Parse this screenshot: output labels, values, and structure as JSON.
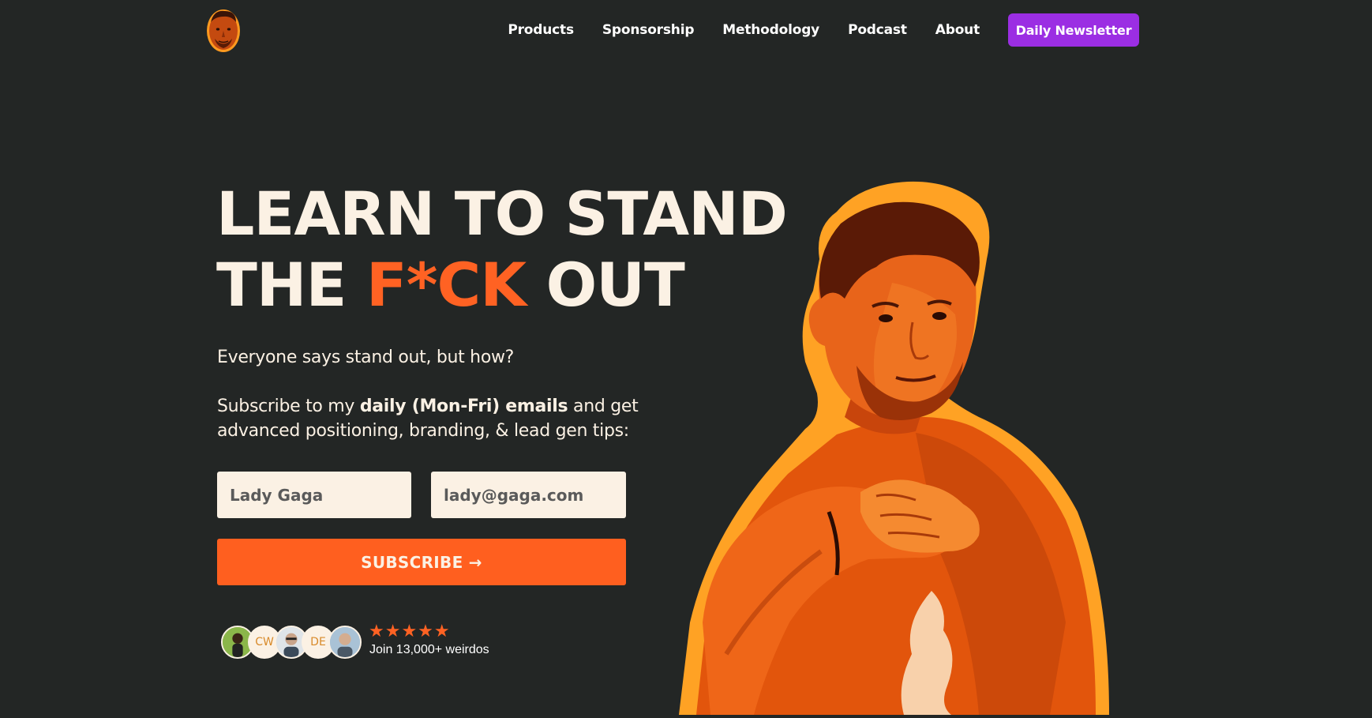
{
  "nav": {
    "items": [
      "Products",
      "Sponsorship",
      "Methodology",
      "Podcast",
      "About"
    ],
    "cta_label": "Daily Newsletter"
  },
  "hero": {
    "headline_line1": "LEARN TO STAND",
    "headline_line2_start": "THE",
    "headline_accent": "F*CK",
    "headline_line2_end": "OUT",
    "lead": "Everyone says stand out, but how?",
    "sub_before": "Subscribe to my ",
    "sub_bold": "daily (Mon-Fri) emails",
    "sub_after": " and get advanced positioning, branding, & lead gen tips:"
  },
  "form": {
    "name_placeholder": "Lady Gaga",
    "email_placeholder": "lady@gaga.com",
    "submit_label": "SUBSCRIBE →"
  },
  "social_proof": {
    "avatars": [
      {
        "type": "photo",
        "initials": ""
      },
      {
        "type": "initials",
        "initials": "CW"
      },
      {
        "type": "photo",
        "initials": ""
      },
      {
        "type": "initials",
        "initials": "DE"
      },
      {
        "type": "photo",
        "initials": ""
      }
    ],
    "stars": "★★★★★",
    "rating": 5,
    "join_text": "Join 13,000+ weirdos"
  },
  "colors": {
    "background": "#232625",
    "accent": "#ff6223",
    "cta": "#9b2ee3",
    "cream": "#fbf1e4"
  }
}
